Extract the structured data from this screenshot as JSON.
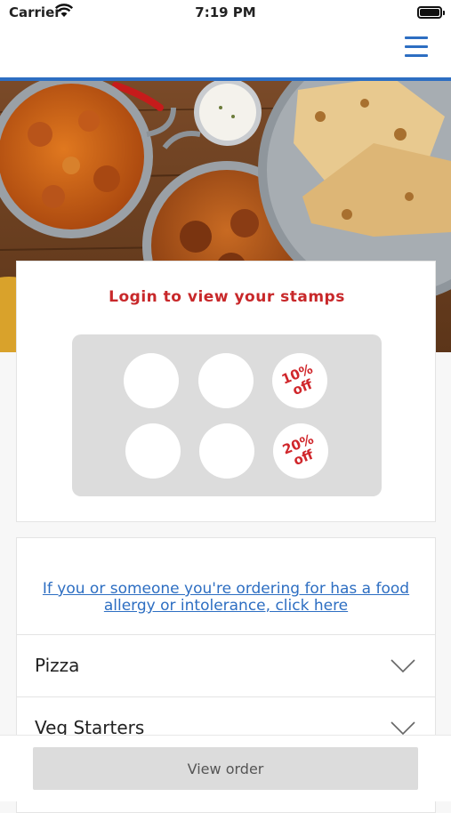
{
  "status_bar": {
    "carrier": "Carrier",
    "time": "7:19 PM"
  },
  "nav": {
    "menu_icon": "hamburger-menu-icon",
    "accent_color": "#2d6ec2"
  },
  "hero": {
    "image": "indian-food-curry-naan-photo"
  },
  "stamps": {
    "title": "Login to view your stamps",
    "rewards": [
      {
        "line1": "10%",
        "line2": "off"
      },
      {
        "line1": "20%",
        "line2": "off"
      }
    ],
    "title_color": "#c8282a"
  },
  "menu": {
    "allergy_link": "If you or someone you're ordering for has a food allergy or intolerance, click here",
    "categories": [
      {
        "label": "Pizza"
      },
      {
        "label": "Veg Starters"
      }
    ]
  },
  "bottom": {
    "view_order_label": "View order"
  }
}
